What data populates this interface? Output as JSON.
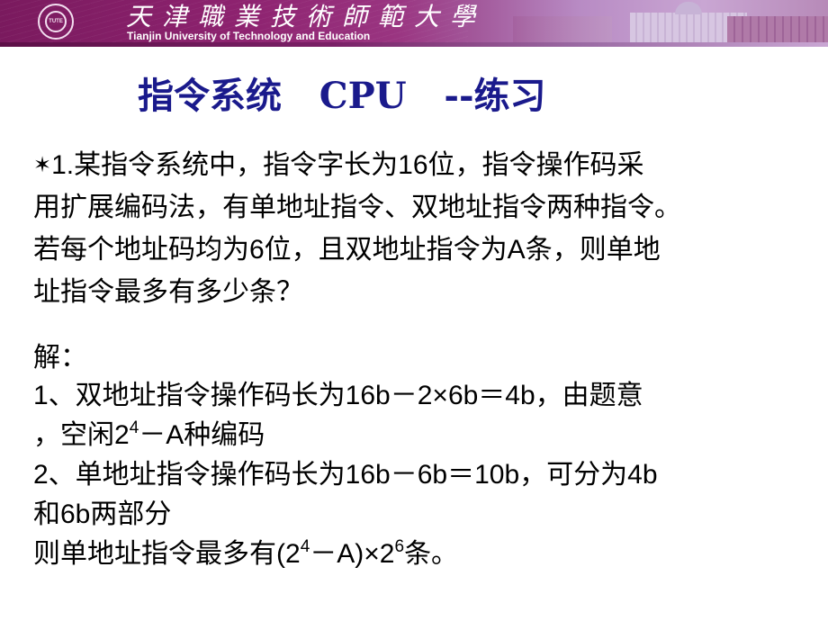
{
  "banner": {
    "university_cn": "天津職業技術師範大學",
    "university_en": "Tianjin University of Technology and Education",
    "logo_text": "TUTE",
    "colors": {
      "primary": "#8e2370",
      "light": "#c9a6d3"
    }
  },
  "slide": {
    "title": "指令系统   CPU   --练习",
    "title_color": "#1a1a8c",
    "question": {
      "marker": "✶",
      "lines": [
        "1.某指令系统中，指令字长为16位，指令操作码采",
        "用扩展编码法，有单地址指令、双地址指令两种指令。",
        "若每个地址码均为6位，且双地址指令为A条，则单地",
        "址指令最多有多少条？"
      ]
    },
    "answer": {
      "heading": "解：",
      "line1": "1、双地址指令操作码长为16b－2×6b＝4b，由题意",
      "line2_pre": "，空闲2",
      "line2_sup": "4",
      "line2_post": "－A种编码",
      "line3": "2、单地址指令操作码长为16b－6b＝10b，可分为4b",
      "line4": "和6b两部分",
      "line5_pre": "则单地址指令最多有(2",
      "line5_sup1": "4",
      "line5_mid": "－A)×2",
      "line5_sup2": "6",
      "line5_post": "条。"
    }
  }
}
